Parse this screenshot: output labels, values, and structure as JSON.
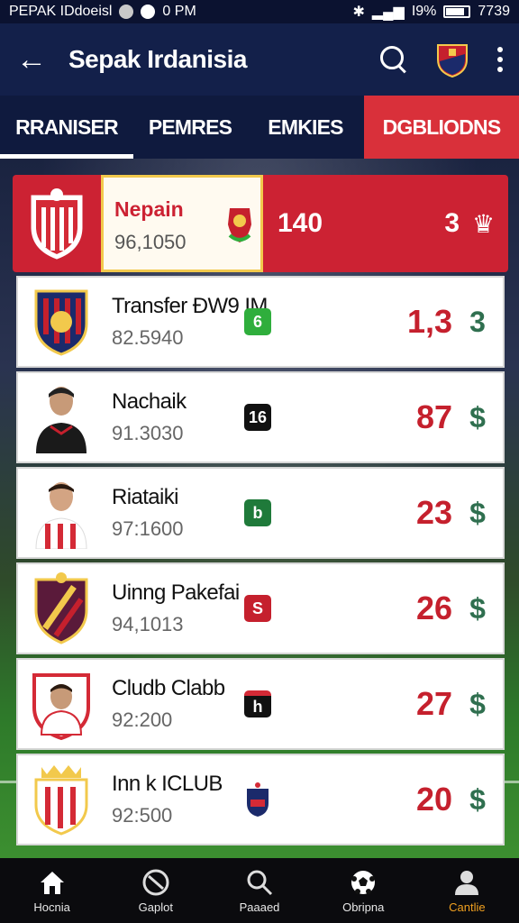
{
  "status_bar": {
    "carrier": "PEPAK IDdoeisl",
    "time_left": "0 PM",
    "battery": "I9%",
    "time_right": "7739"
  },
  "app_bar": {
    "title": "Sepak Irdanisia"
  },
  "tabs": [
    {
      "label": "RRANISER"
    },
    {
      "label": "PEMRES"
    },
    {
      "label": "EMKIES"
    },
    {
      "label": "DGBLIODNS"
    }
  ],
  "header_row": {
    "name": "Nepain",
    "sub": "96,1050",
    "value1": "140",
    "value2": "3"
  },
  "rows": [
    {
      "name": "Transfer ÐW9 IM",
      "sub": "82.5940",
      "chip": "6",
      "chip_color": "#2fae3c",
      "value": "1,3",
      "symbol": "3"
    },
    {
      "name": "Nachaik",
      "sub": "91.3030",
      "chip": "16",
      "chip_color": "#111111",
      "value": "87",
      "symbol": "$"
    },
    {
      "name": "Riataiki",
      "sub": "97:1600",
      "chip": "b",
      "chip_color": "#1f7a3a",
      "value": "23",
      "symbol": "$"
    },
    {
      "name": "Uinng Pakefai",
      "sub": "94,1013",
      "chip": "S",
      "chip_color": "#c5202d",
      "value": "26",
      "symbol": "$"
    },
    {
      "name": "Cludb Clabb",
      "sub": "92:200",
      "chip": "h",
      "chip_color": "#111111",
      "value": "27",
      "symbol": "$"
    },
    {
      "name": "Inn k ICLUB",
      "sub": "92:500",
      "chip": "",
      "chip_color": "#1b2a6b",
      "value": "20",
      "symbol": "$"
    }
  ],
  "bottom_nav": [
    {
      "label": "Hocnia",
      "icon": "home-icon"
    },
    {
      "label": "Gaplot",
      "icon": "whistle-icon"
    },
    {
      "label": "Paaaed",
      "icon": "search-icon"
    },
    {
      "label": "Obripna",
      "icon": "ball-icon"
    },
    {
      "label": "Cantlie",
      "icon": "profile-icon"
    }
  ],
  "colors": {
    "accent_red": "#d9303a",
    "navy": "#13204a",
    "active_nav": "#f0a020"
  }
}
